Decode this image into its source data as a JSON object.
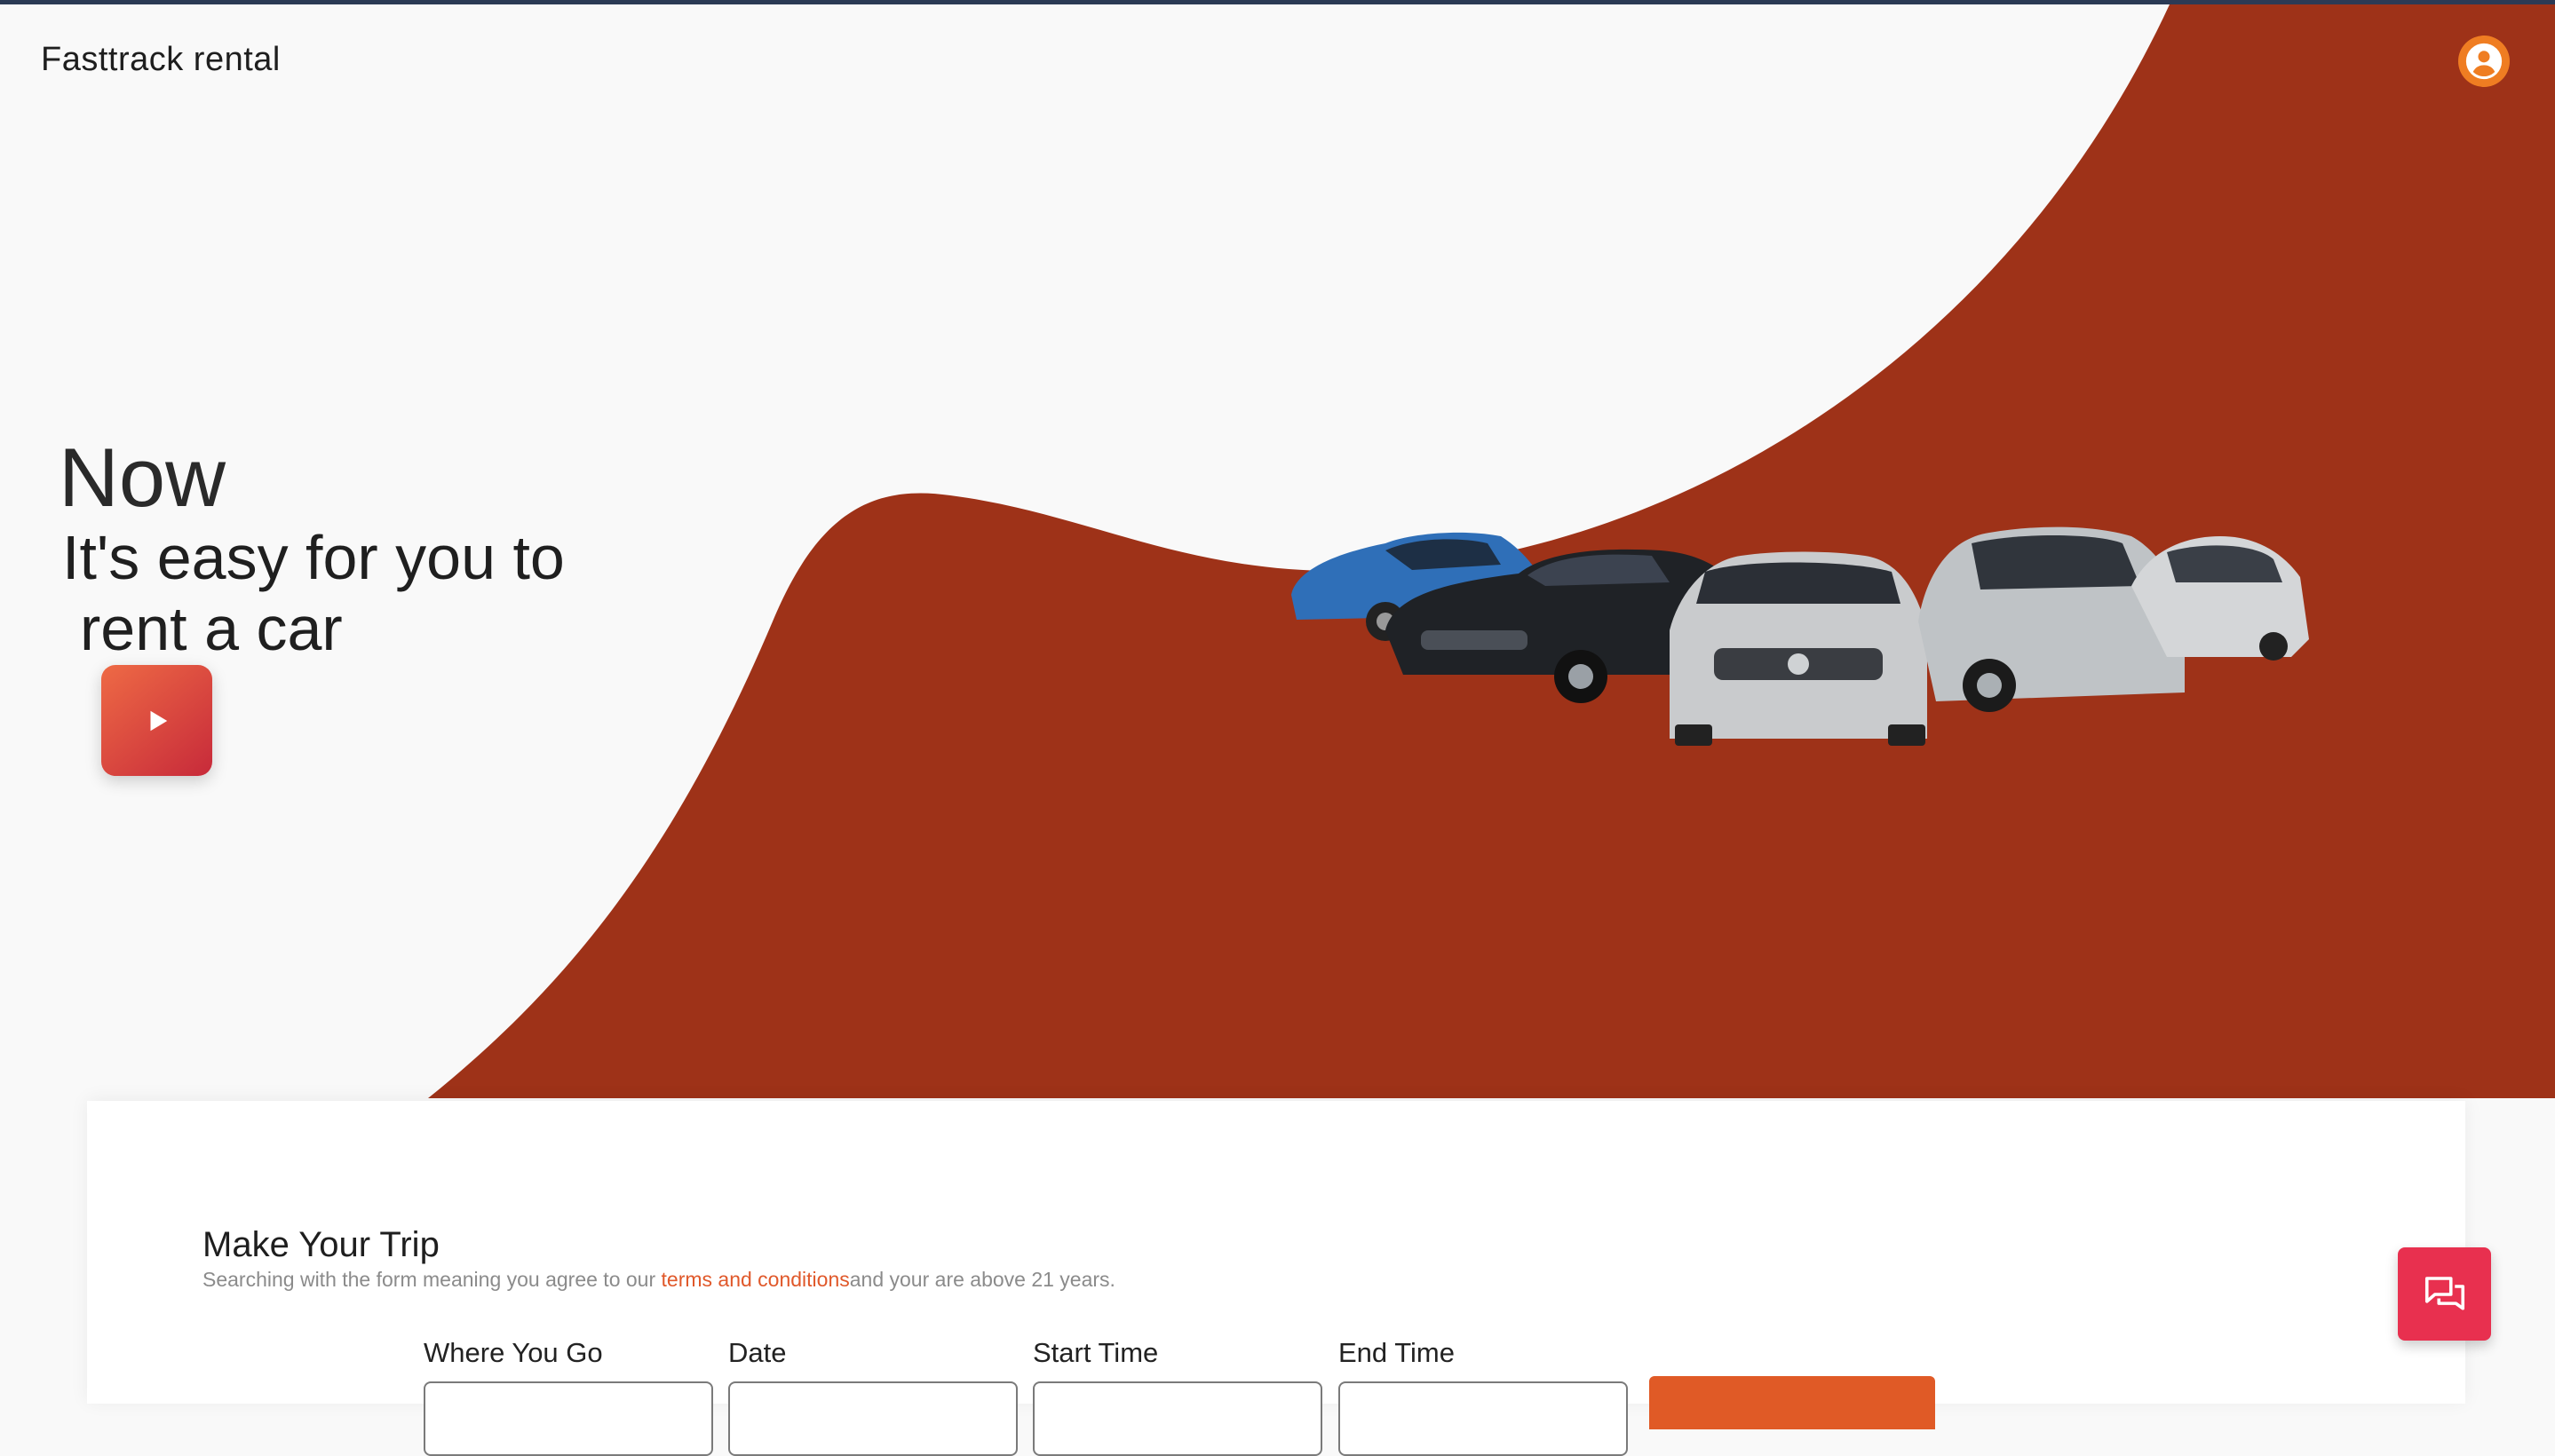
{
  "header": {
    "brand": "Fasttrack rental",
    "account_icon": "account-circle-icon"
  },
  "hero": {
    "eyebrow": "Now",
    "tagline_line1": "It's easy for you to",
    "tagline_line2": "rent a car",
    "play_icon": "play-icon",
    "gradient_colors": [
      "#e3da42",
      "#dc9a38",
      "#df6a2c",
      "#9e3218"
    ]
  },
  "trip": {
    "title": "Make Your Trip",
    "subtitle_before": "Searching with the form meaning you agree to our ",
    "terms_link": "terms and conditions",
    "subtitle_after": "and your are above 21 years.",
    "fields": [
      {
        "label": "Where You Go",
        "value": ""
      },
      {
        "label": "Date",
        "value": ""
      },
      {
        "label": "Start Time",
        "value": ""
      },
      {
        "label": "End Time",
        "value": ""
      }
    ],
    "search_button_label": ""
  },
  "chat": {
    "icon": "chat-icon"
  },
  "colors": {
    "accent": "#e05a26",
    "chat": "#e8304f",
    "account": "#ef7d22"
  }
}
